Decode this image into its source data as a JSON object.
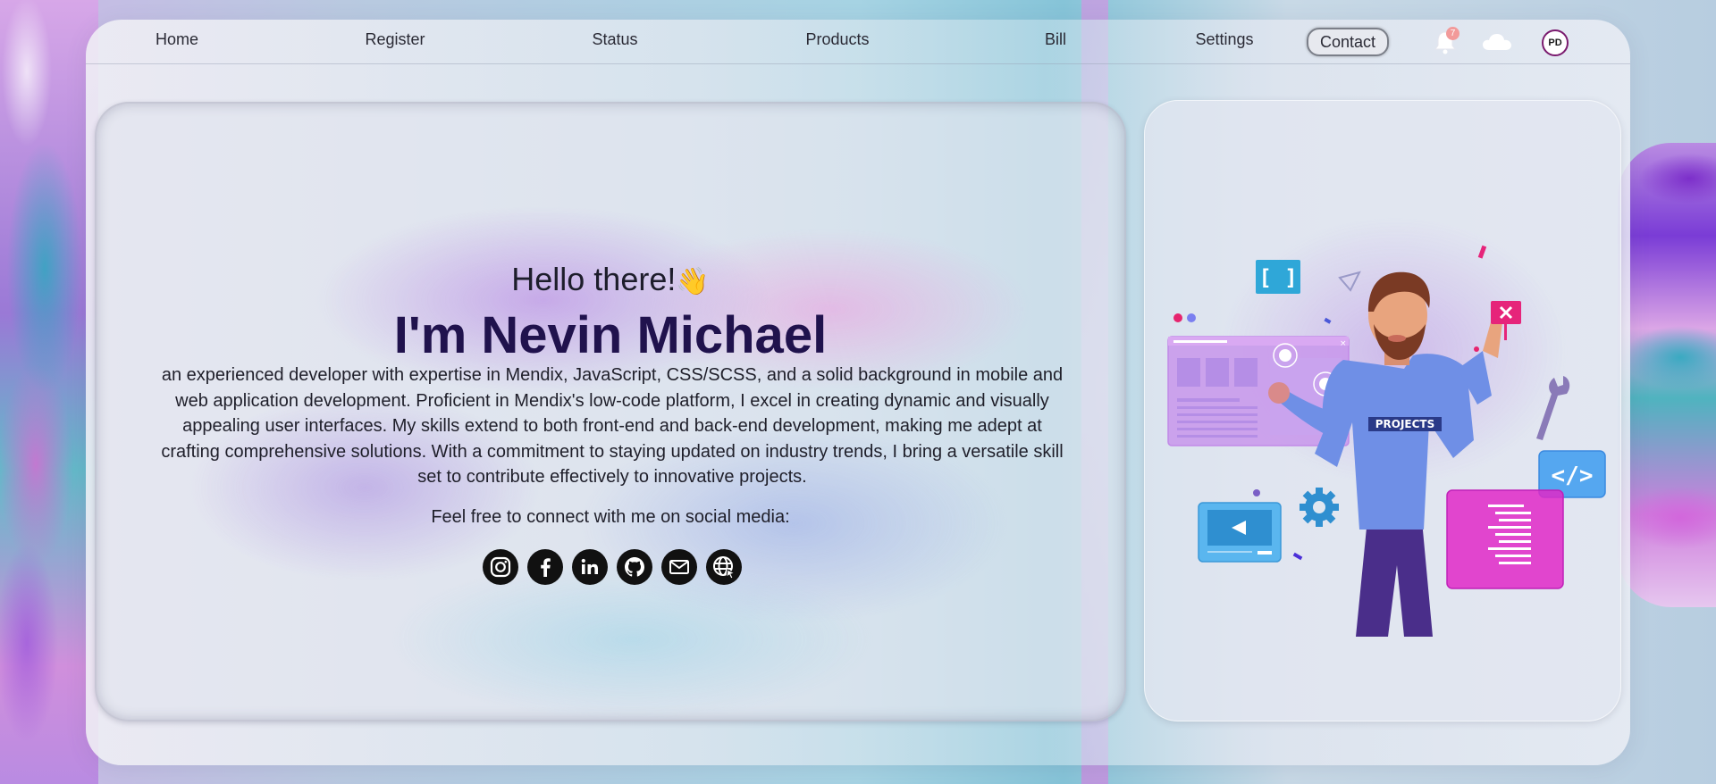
{
  "nav": {
    "items": [
      "Home",
      "Register",
      "Status",
      "Products",
      "Bill",
      "Settings"
    ],
    "contact": "Contact",
    "notification_count": "7",
    "avatar_initials": "PD"
  },
  "hero": {
    "greeting": "Hello there!",
    "greeting_emoji": "👋",
    "name": "I'm Nevin Michael",
    "bio": "an experienced developer with expertise in Mendix, JavaScript, CSS/SCSS, and a solid background in mobile and web application development. Proficient in Mendix's low-code platform, I excel in creating dynamic and visually appealing user interfaces. My skills extend to both front-end and back-end development, making me adept at crafting comprehensive solutions. With a commitment to staying updated on industry trends, I bring a versatile skill set to contribute effectively to innovative projects.",
    "connect_text": "Feel free to connect with me on social media:",
    "socials": [
      "instagram-icon",
      "facebook-icon",
      "linkedin-icon",
      "github-icon",
      "email-icon",
      "website-icon"
    ]
  },
  "illustration": {
    "shirt_text": "PROJECTS"
  },
  "colors": {
    "name": "#20124d",
    "badge": "#f29a9a",
    "avatar_ring": "#7a1a6e"
  }
}
